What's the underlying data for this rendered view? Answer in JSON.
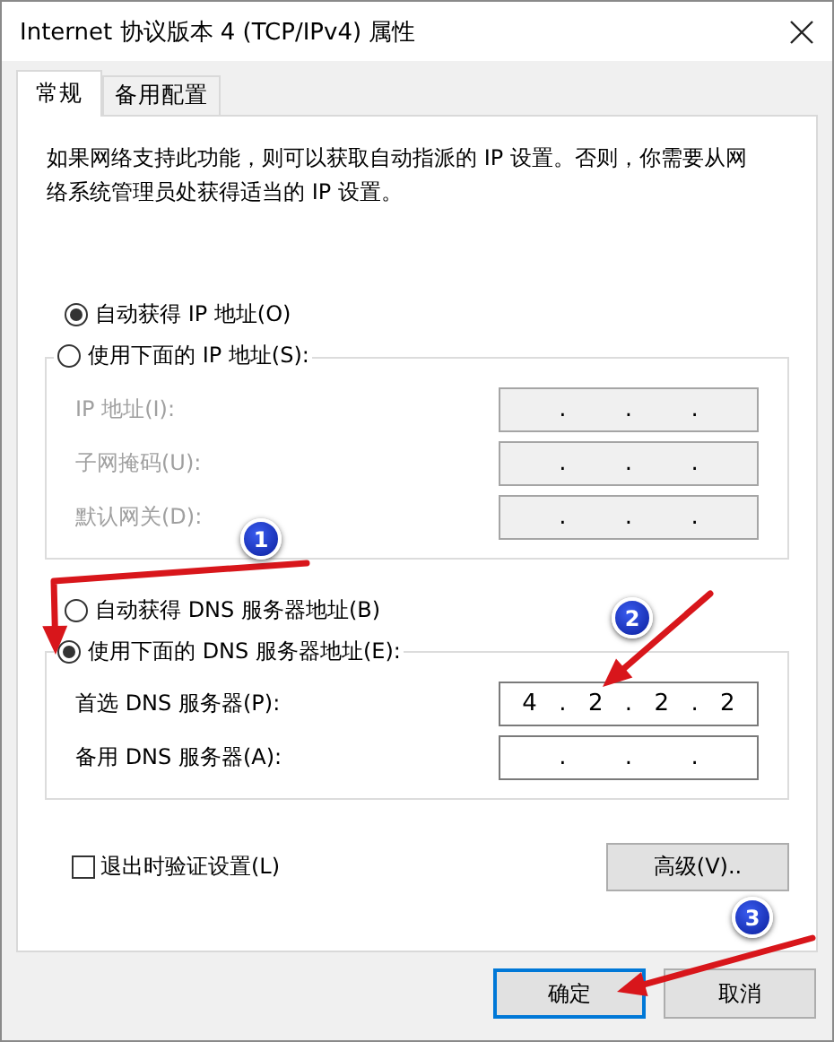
{
  "window": {
    "title": "Internet 协议版本 4 (TCP/IPv4) 属性"
  },
  "tabs": [
    {
      "label": "常规",
      "selected": true
    },
    {
      "label": "备用配置",
      "selected": false
    }
  ],
  "description": "如果网络支持此功能，则可以获取自动指派的 IP 设置。否则，你需要从网络系统管理员处获得适当的 IP 设置。",
  "ip_section": {
    "options": [
      {
        "label": "自动获得 IP 地址(O)",
        "selected": true
      },
      {
        "label": "使用下面的 IP 地址(S):",
        "selected": false
      }
    ],
    "fields": [
      {
        "label": "IP 地址(I):",
        "disabled": true,
        "separator": "."
      },
      {
        "label": "子网掩码(U):",
        "disabled": true,
        "separator": "."
      },
      {
        "label": "默认网关(D):",
        "disabled": true,
        "separator": "."
      }
    ]
  },
  "dns_section": {
    "options": [
      {
        "label": "自动获得 DNS 服务器地址(B)",
        "selected": false
      },
      {
        "label": "使用下面的 DNS 服务器地址(E):",
        "selected": true
      }
    ],
    "fields": [
      {
        "label": "首选 DNS 服务器(P):",
        "disabled": false,
        "separator": ".",
        "octets": [
          "4",
          "2",
          "2",
          "2"
        ]
      },
      {
        "label": "备用 DNS 服务器(A):",
        "disabled": false,
        "separator": "."
      }
    ]
  },
  "verify_checkbox": {
    "label": "退出时验证设置(L)",
    "checked": false
  },
  "advanced_button": "高级(V)..",
  "buttons": [
    {
      "label": "确定",
      "default": true
    },
    {
      "label": "取消",
      "default": false
    }
  ],
  "annotations": [
    {
      "number": "1"
    },
    {
      "number": "2"
    },
    {
      "number": "3"
    }
  ]
}
